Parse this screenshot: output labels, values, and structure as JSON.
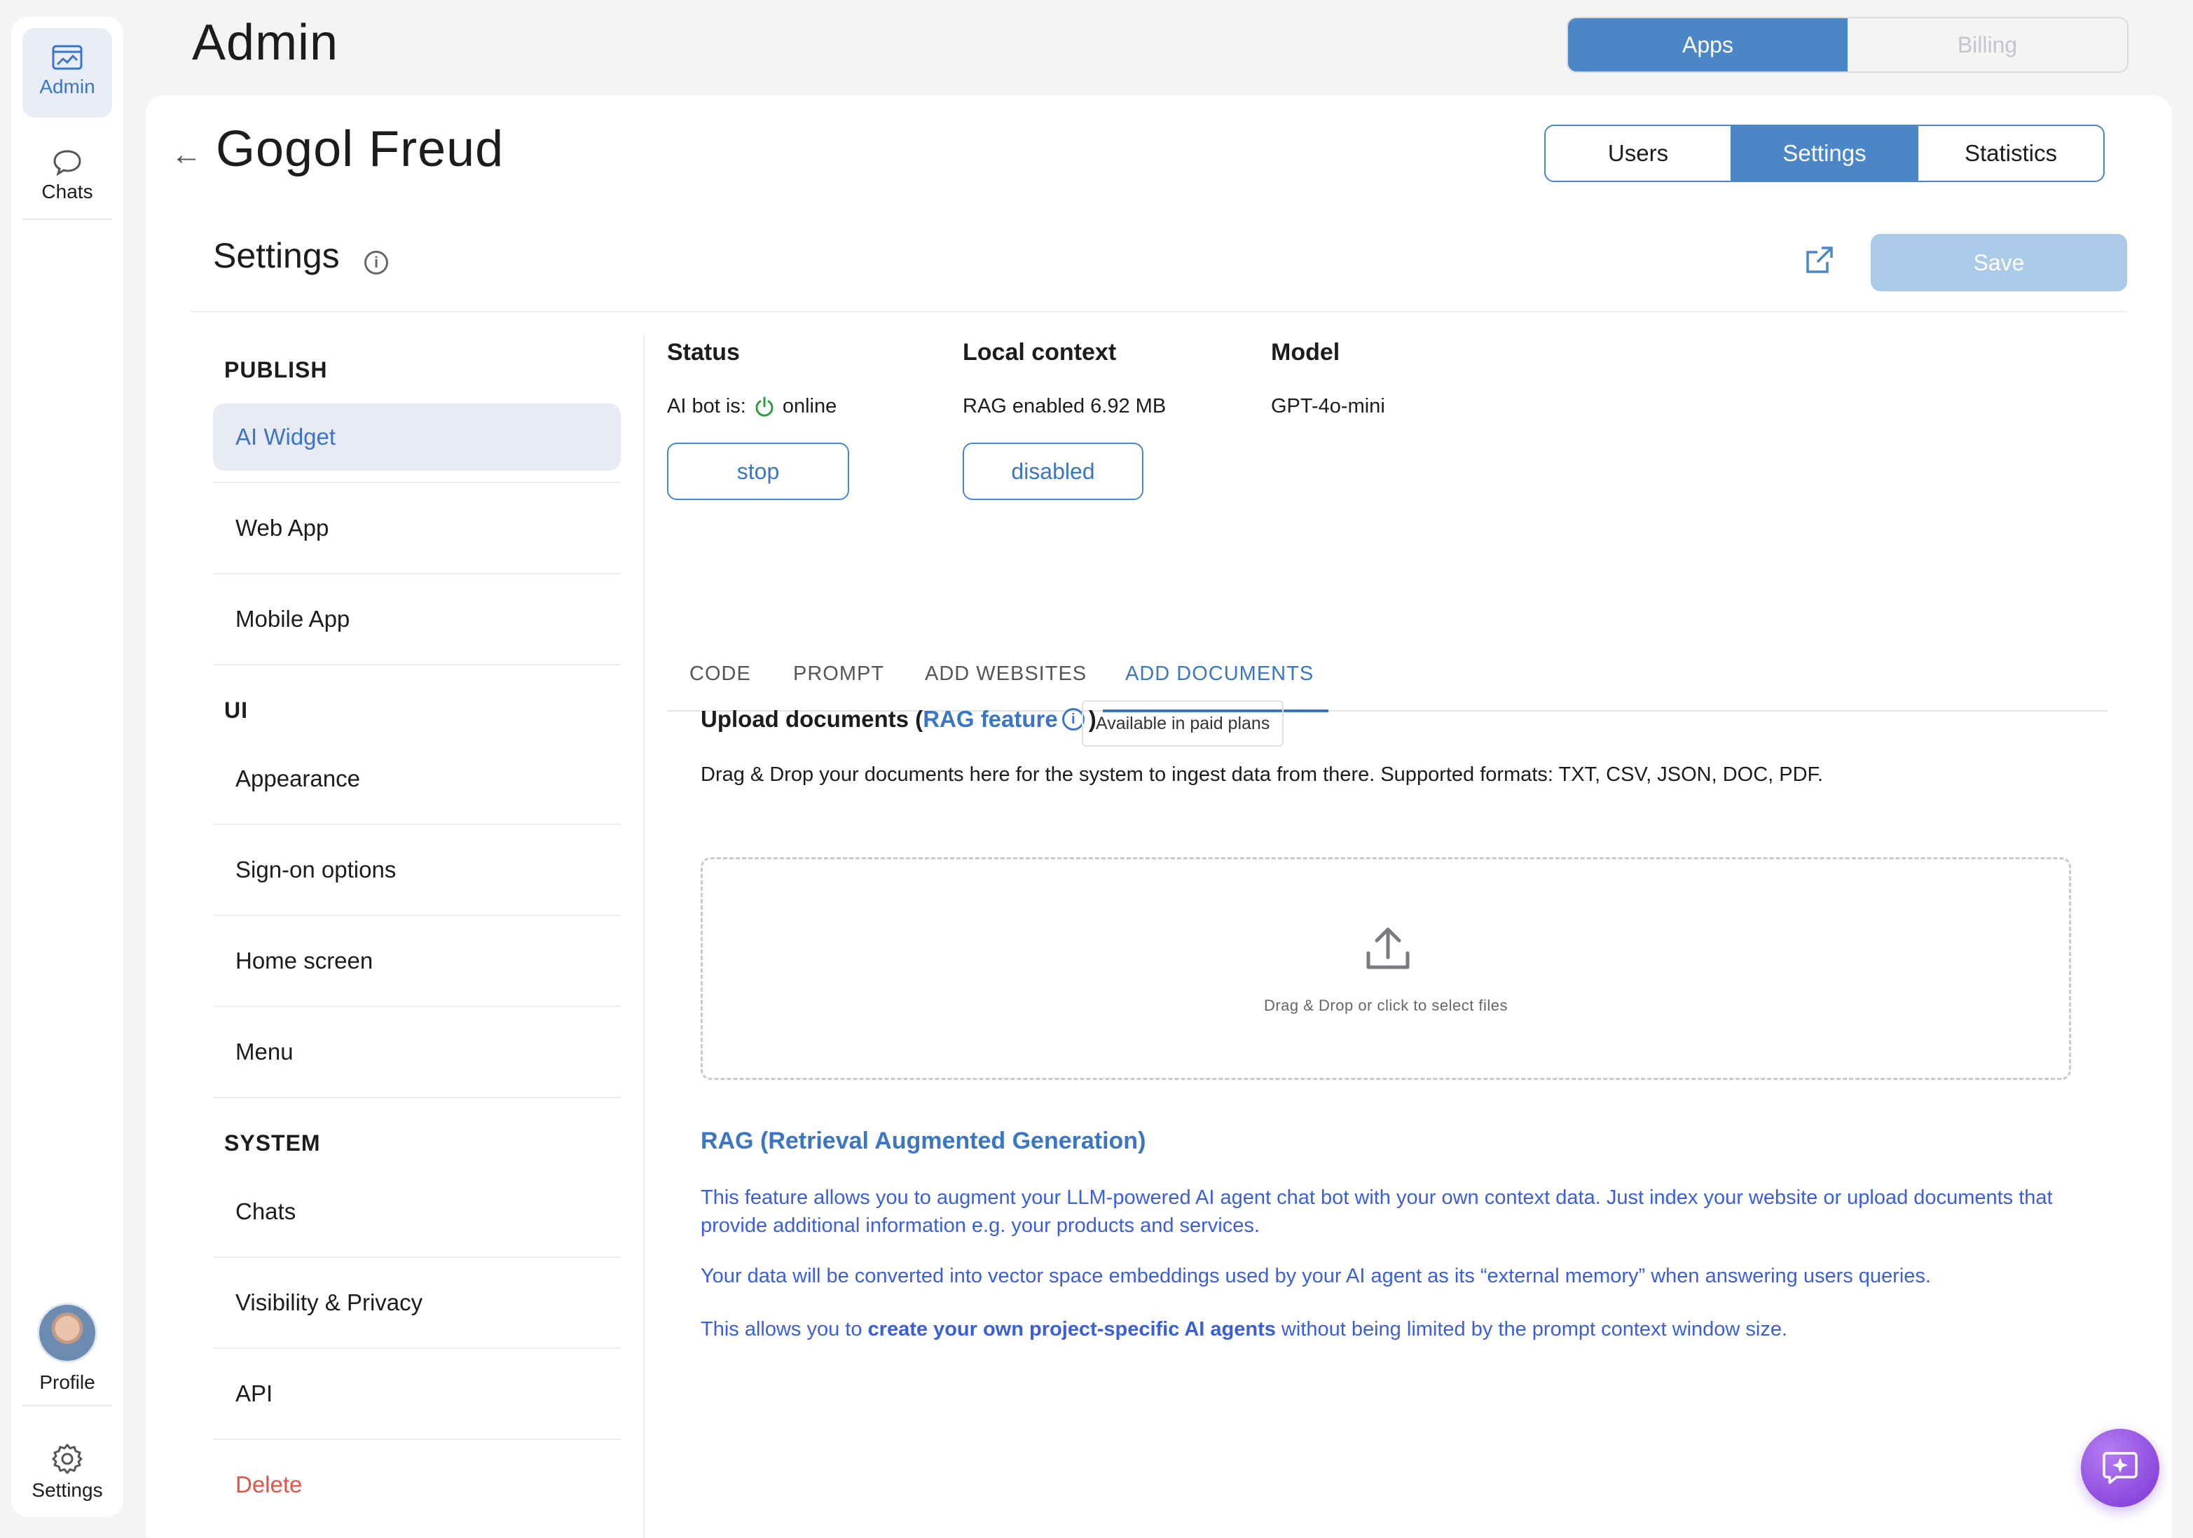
{
  "rail": {
    "admin": {
      "label": "Admin",
      "icon": "dashboard-icon"
    },
    "chats": {
      "label": "Chats",
      "icon": "chat-bubble-icon"
    },
    "profile": {
      "label": "Profile",
      "icon": "avatar"
    },
    "settings": {
      "label": "Settings",
      "icon": "gear-icon"
    }
  },
  "header": {
    "title": "Admin",
    "tabs": [
      "Apps",
      "Billing"
    ],
    "active_tab": "Apps"
  },
  "app": {
    "name": "Gogol Freud",
    "tabs": [
      "Users",
      "Settings",
      "Statistics"
    ],
    "active_tab": "Settings"
  },
  "settings": {
    "title": "Settings",
    "save_label": "Save"
  },
  "nav": {
    "publish_heading": "PUBLISH",
    "publish": [
      "AI Widget",
      "Web App",
      "Mobile App"
    ],
    "ui_heading": "UI",
    "ui": [
      "Appearance",
      "Sign-on options",
      "Home screen",
      "Menu"
    ],
    "system_heading": "SYSTEM",
    "system": [
      "Chats",
      "Visibility & Privacy",
      "API",
      "Delete"
    ],
    "active": "AI Widget"
  },
  "status": {
    "status_heading": "Status",
    "bot_label": "AI bot is:",
    "bot_state": "online",
    "stop_label": "stop",
    "context_heading": "Local context",
    "context_value": "RAG enabled 6.92 MB",
    "context_button": "disabled",
    "model_heading": "Model",
    "model_value": "GPT-4o-mini"
  },
  "content_tabs": {
    "items": [
      "CODE",
      "PROMPT",
      "ADD WEBSITES",
      "ADD DOCUMENTS"
    ],
    "active": "ADD DOCUMENTS"
  },
  "upload": {
    "title": "Upload documents (",
    "rag_link": "RAG feature",
    "close_paren": ")",
    "badge": "Available in paid plans",
    "description": "Drag & Drop your documents here for the system to ingest data from there. Supported formats: TXT, CSV, JSON, DOC, PDF.",
    "dropzone_text": "Drag & Drop or click to select files"
  },
  "rag": {
    "heading": "RAG (Retrieval Augmented Generation)",
    "p1": "This feature allows you to augment your LLM-powered AI agent chat bot with your own context data. Just index your website or upload documents that provide additional information e.g. your products and services.",
    "p2": "Your data will be converted into vector space embeddings used by your AI agent as its “external memory” when answering users queries.",
    "p3_pre": "This allows you to ",
    "p3_bold": "create your own project-specific AI agents",
    "p3_post": " without being limited by the prompt context window size."
  },
  "colors": {
    "accent": "#4a86c8",
    "accent_text": "#3b76c4",
    "danger": "#e0544b",
    "online": "#2e9a3a",
    "fab": "#8a44e0"
  }
}
